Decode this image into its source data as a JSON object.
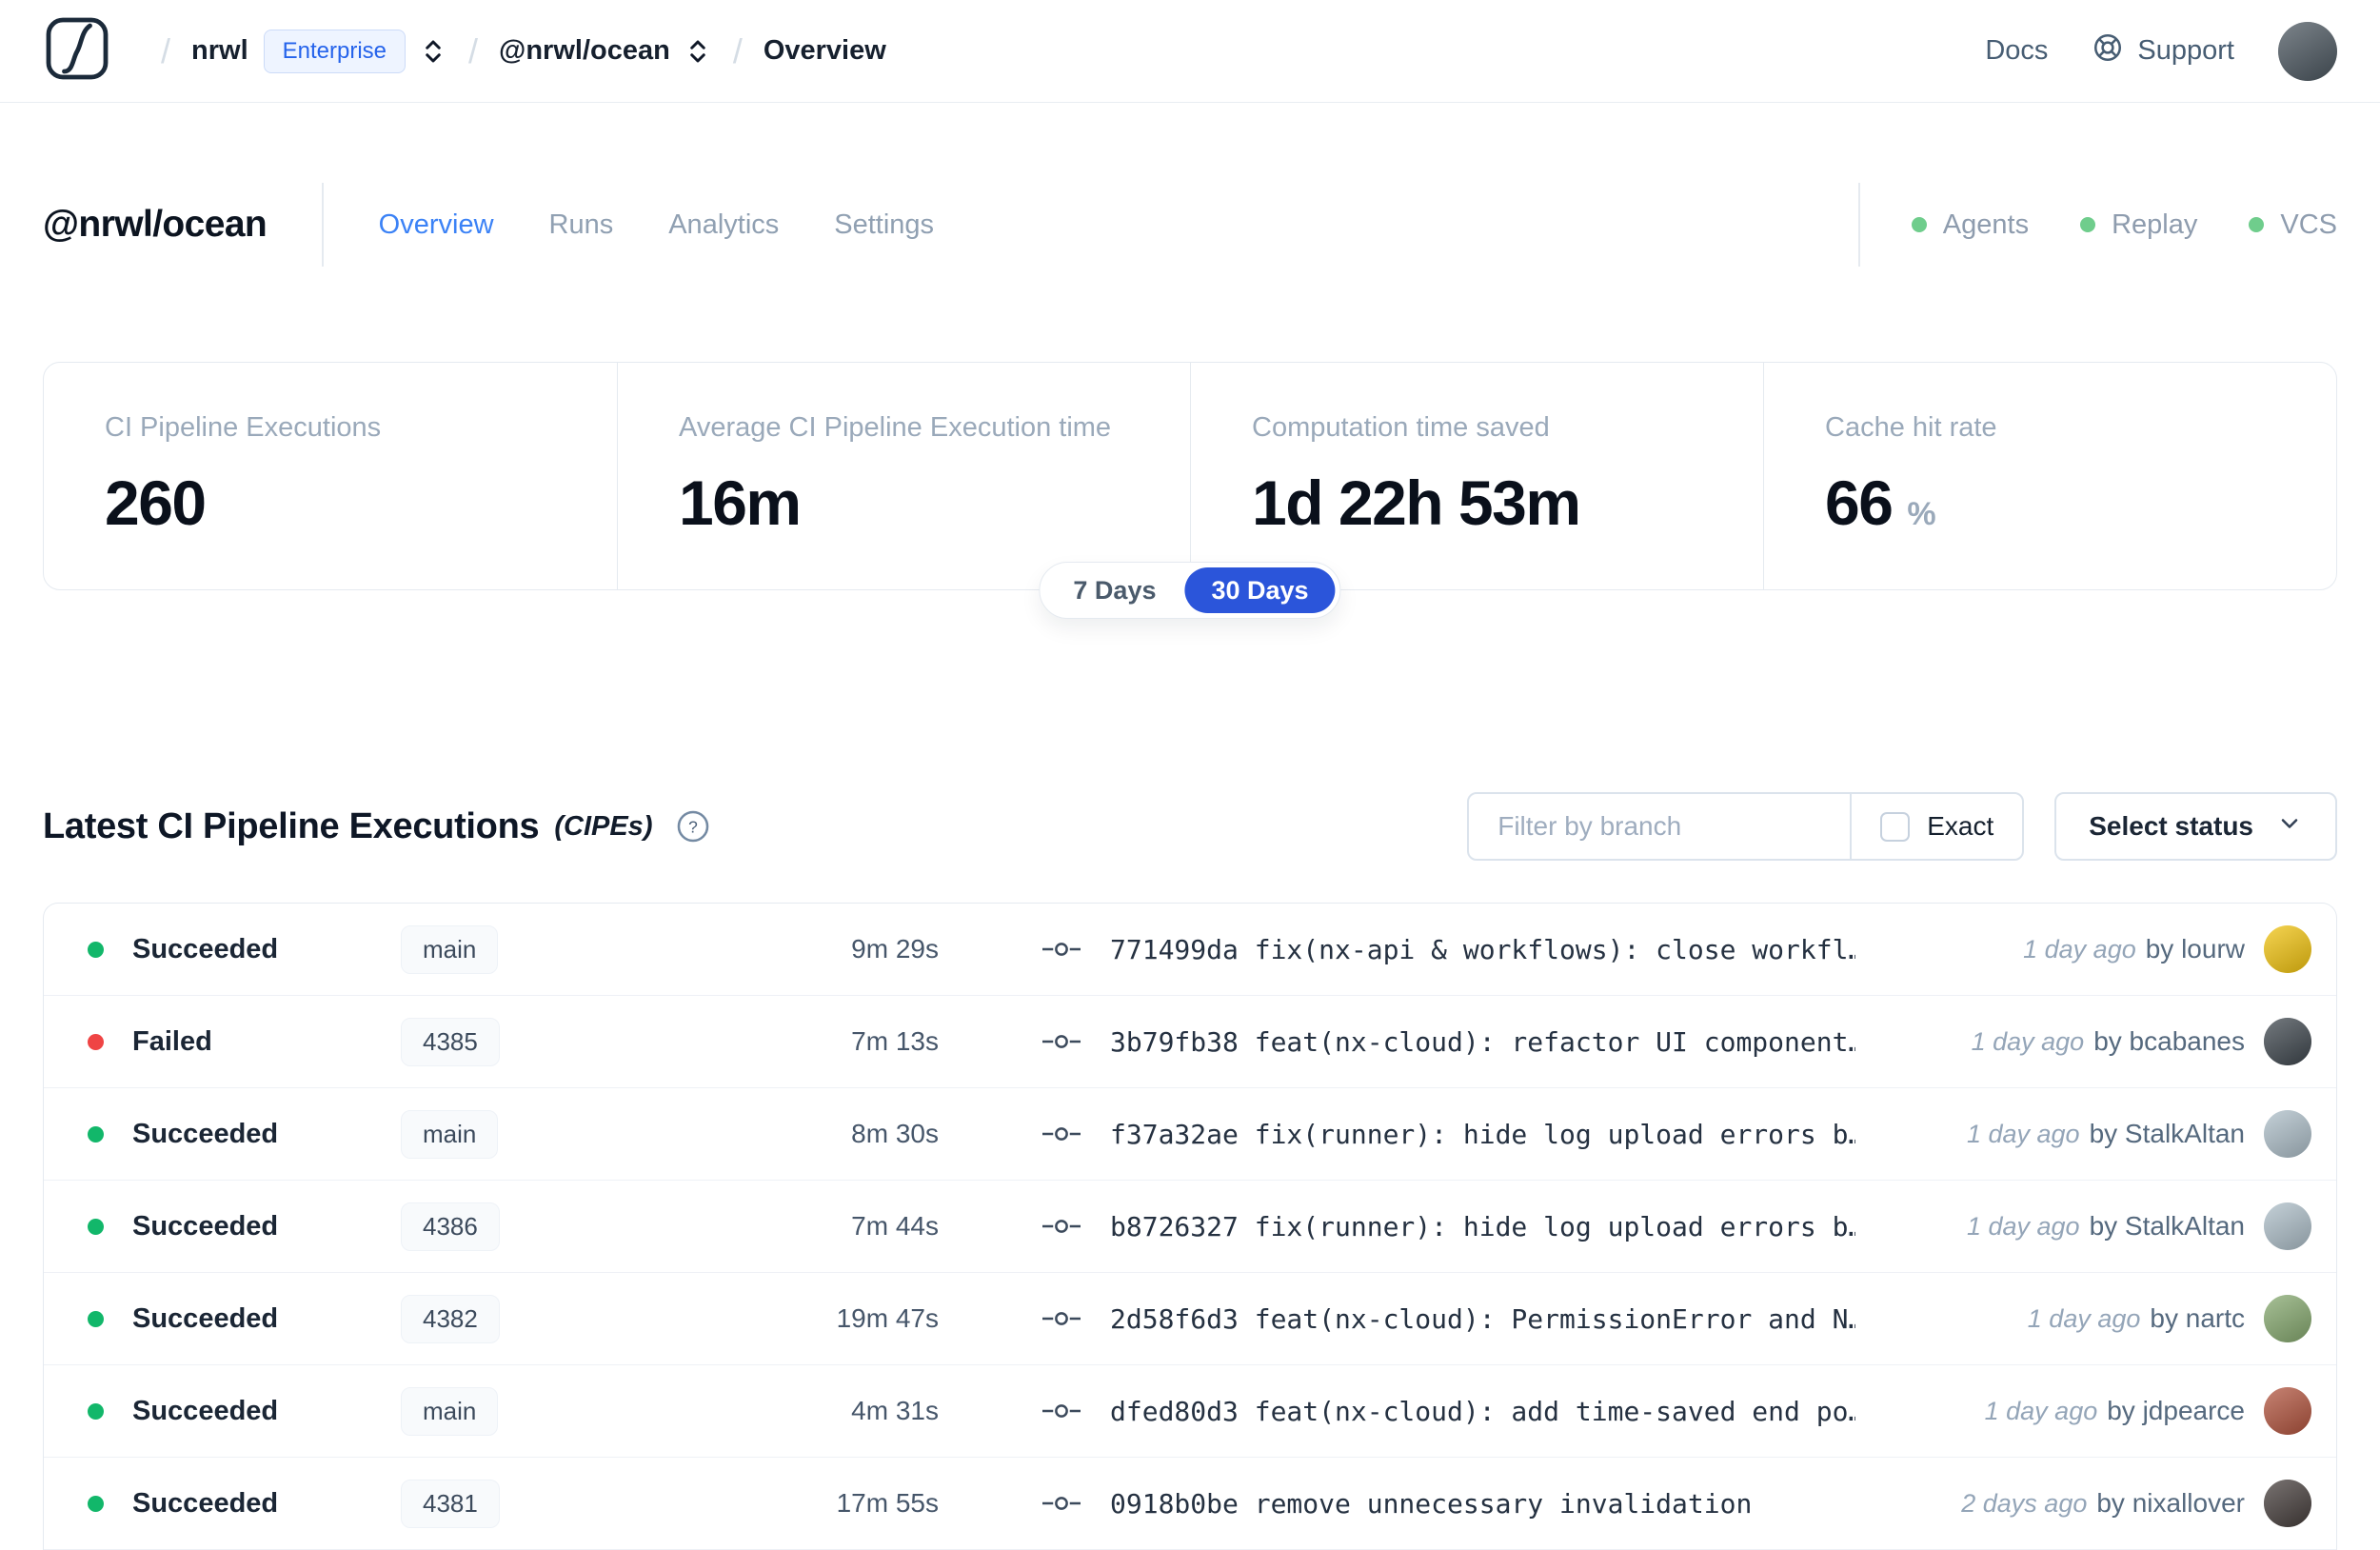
{
  "colors": {
    "accent_blue": "#2b55da",
    "tab_active_blue": "#3b82f6",
    "badge_blue": "#2563eb",
    "feature_dot_green": "#6fcd8c"
  },
  "navbar": {
    "breadcrumb": {
      "separator": "/",
      "org": "nrwl",
      "org_badge": "Enterprise",
      "workspace": "@nrwl/ocean",
      "page": "Overview"
    },
    "docs_label": "Docs",
    "support_label": "Support",
    "avatar_color": "#4b565f"
  },
  "workspace_header": {
    "title": "@nrwl/ocean",
    "tabs": [
      {
        "label": "Overview"
      },
      {
        "label": "Runs"
      },
      {
        "label": "Analytics"
      },
      {
        "label": "Settings"
      }
    ],
    "features": [
      {
        "label": "Agents"
      },
      {
        "label": "Replay"
      },
      {
        "label": "VCS"
      }
    ]
  },
  "stats": {
    "cards": [
      {
        "label": "CI Pipeline Executions",
        "value": "260",
        "suffix": ""
      },
      {
        "label": "Average CI Pipeline Execution time",
        "value": "16m",
        "suffix": ""
      },
      {
        "label": "Computation time saved",
        "value": "1d 22h 53m",
        "suffix": ""
      },
      {
        "label": "Cache hit rate",
        "value": "66",
        "suffix": "%"
      }
    ],
    "period_toggle": {
      "inactive_label": "7 Days",
      "active_label": "30 Days"
    }
  },
  "cipes": {
    "title": "Latest CI Pipeline Executions",
    "title_suffix": "(CIPEs)",
    "help_glyph": "?",
    "filter": {
      "branch_placeholder": "Filter by branch",
      "exact_label": "Exact",
      "status_button": "Select status"
    },
    "rows": [
      {
        "status": "Succeeded",
        "dot_color": "#12b76a",
        "branch": "main",
        "duration": "9m 29s",
        "commit": "771499da fix(nx-api & workflows): close workfl…",
        "time_ago": "1 day ago",
        "author": "by lourw",
        "avatar_color": "#f2c410"
      },
      {
        "status": "Failed",
        "dot_color": "#ef4444",
        "branch": "4385",
        "duration": "7m 13s",
        "commit": "3b79fb38 feat(nx-cloud): refactor UI component…",
        "time_ago": "1 day ago",
        "author": "by bcabanes",
        "avatar_color": "#3f474e"
      },
      {
        "status": "Succeeded",
        "dot_color": "#12b76a",
        "branch": "main",
        "duration": "8m 30s",
        "commit": "f37a32ae fix(runner): hide log upload errors b…",
        "time_ago": "1 day ago",
        "author": "by StalkAltan",
        "avatar_color": "#aebfc9"
      },
      {
        "status": "Succeeded",
        "dot_color": "#12b76a",
        "branch": "4386",
        "duration": "7m 44s",
        "commit": "b8726327 fix(runner): hide log upload errors b…",
        "time_ago": "1 day ago",
        "author": "by StalkAltan",
        "avatar_color": "#aebfc9"
      },
      {
        "status": "Succeeded",
        "dot_color": "#12b76a",
        "branch": "4382",
        "duration": "19m 47s",
        "commit": "2d58f6d3 feat(nx-cloud): PermissionError and N…",
        "time_ago": "1 day ago",
        "author": "by nartc",
        "avatar_color": "#86a96f"
      },
      {
        "status": "Succeeded",
        "dot_color": "#12b76a",
        "branch": "main",
        "duration": "4m 31s",
        "commit": "dfed80d3 feat(nx-cloud): add time-saved end po…",
        "time_ago": "1 day ago",
        "author": "by jdpearce",
        "avatar_color": "#b2543e"
      },
      {
        "status": "Succeeded",
        "dot_color": "#12b76a",
        "branch": "4381",
        "duration": "17m 55s",
        "commit": "0918b0be remove unnecessary invalidation",
        "time_ago": "2 days ago",
        "author": "by nixallover",
        "avatar_color": "#463e3c"
      }
    ]
  }
}
